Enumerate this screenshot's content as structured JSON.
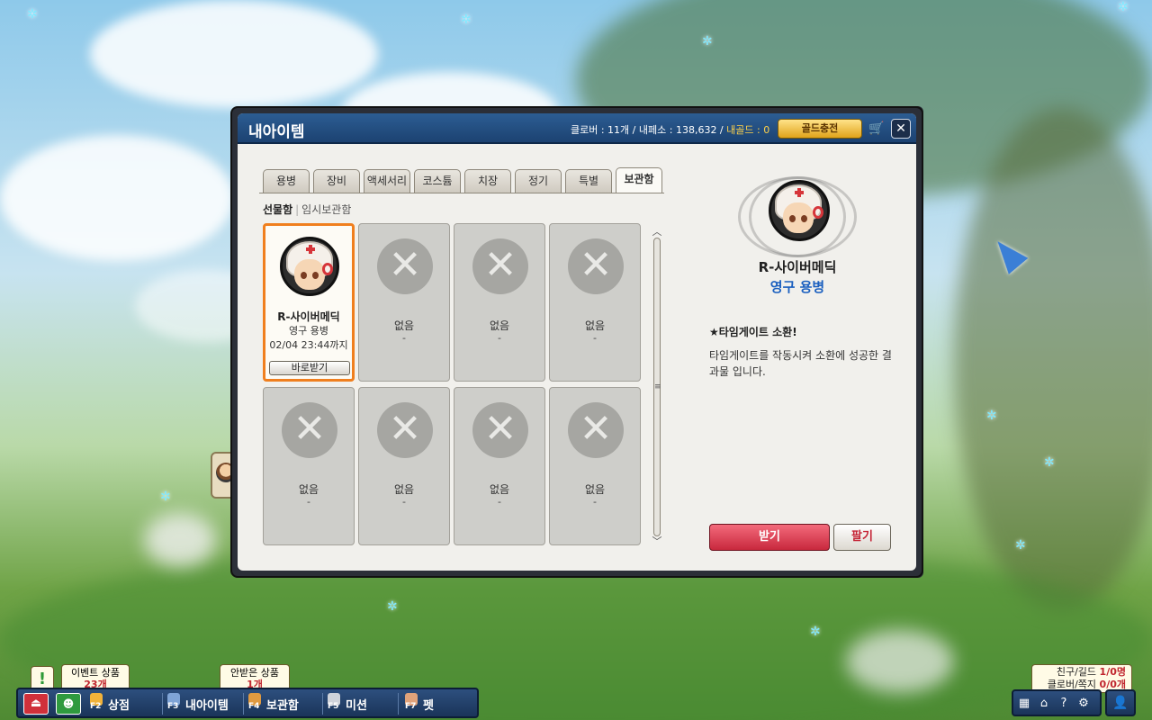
{
  "window": {
    "title": "내아이템",
    "currency": {
      "clover": "클로버 : 11개",
      "sep1": " / ",
      "coin": "내페소 : 138,632",
      "sep2": " / ",
      "gold": "내골드 : 0"
    },
    "gold_charge_label": "골드충전"
  },
  "tabs": [
    {
      "label": "용병",
      "active": false
    },
    {
      "label": "장비",
      "active": false
    },
    {
      "label": "액세서리",
      "active": false
    },
    {
      "label": "코스튬",
      "active": false
    },
    {
      "label": "치장",
      "active": false
    },
    {
      "label": "정기",
      "active": false
    },
    {
      "label": "특별",
      "active": false
    },
    {
      "label": "보관함",
      "active": true
    }
  ],
  "subtabs": {
    "gift": "선물함",
    "separator": "|",
    "temp": "임시보관함"
  },
  "grid": {
    "item": {
      "name": "R-사이버메딕",
      "type": "영구 용병",
      "expiry": "02/04 23:44까지",
      "receive_label": "바로받기"
    },
    "empty_label": "없음",
    "empty_sub": "-"
  },
  "detail": {
    "name": "R-사이버메딕",
    "type": "영구 용병",
    "desc_title": "★타임게이트 소환!",
    "desc": "타임게이트를 작동시켜 소환에 성공한 결과물 입니다.",
    "receive_label": "받기",
    "sell_label": "팔기"
  },
  "taskbar": {
    "event_bubble": {
      "label": "이벤트 상품",
      "count": "23개"
    },
    "unreceived_bubble": {
      "label": "안받은 상품",
      "count": "1개"
    },
    "alert": "!",
    "nav": [
      {
        "fkey": "F2",
        "label": "상점"
      },
      {
        "fkey": "F3",
        "label": "내아이템"
      },
      {
        "fkey": "F4",
        "label": "보관함"
      },
      {
        "fkey": "F5",
        "label": "미션"
      },
      {
        "fkey": "F7",
        "label": "펫"
      }
    ],
    "friends": {
      "label1": "친구/길드",
      "count1": "1/0명",
      "label2": "클로버/쪽지",
      "count2": "0/0개"
    },
    "user_icon_label": "M"
  }
}
